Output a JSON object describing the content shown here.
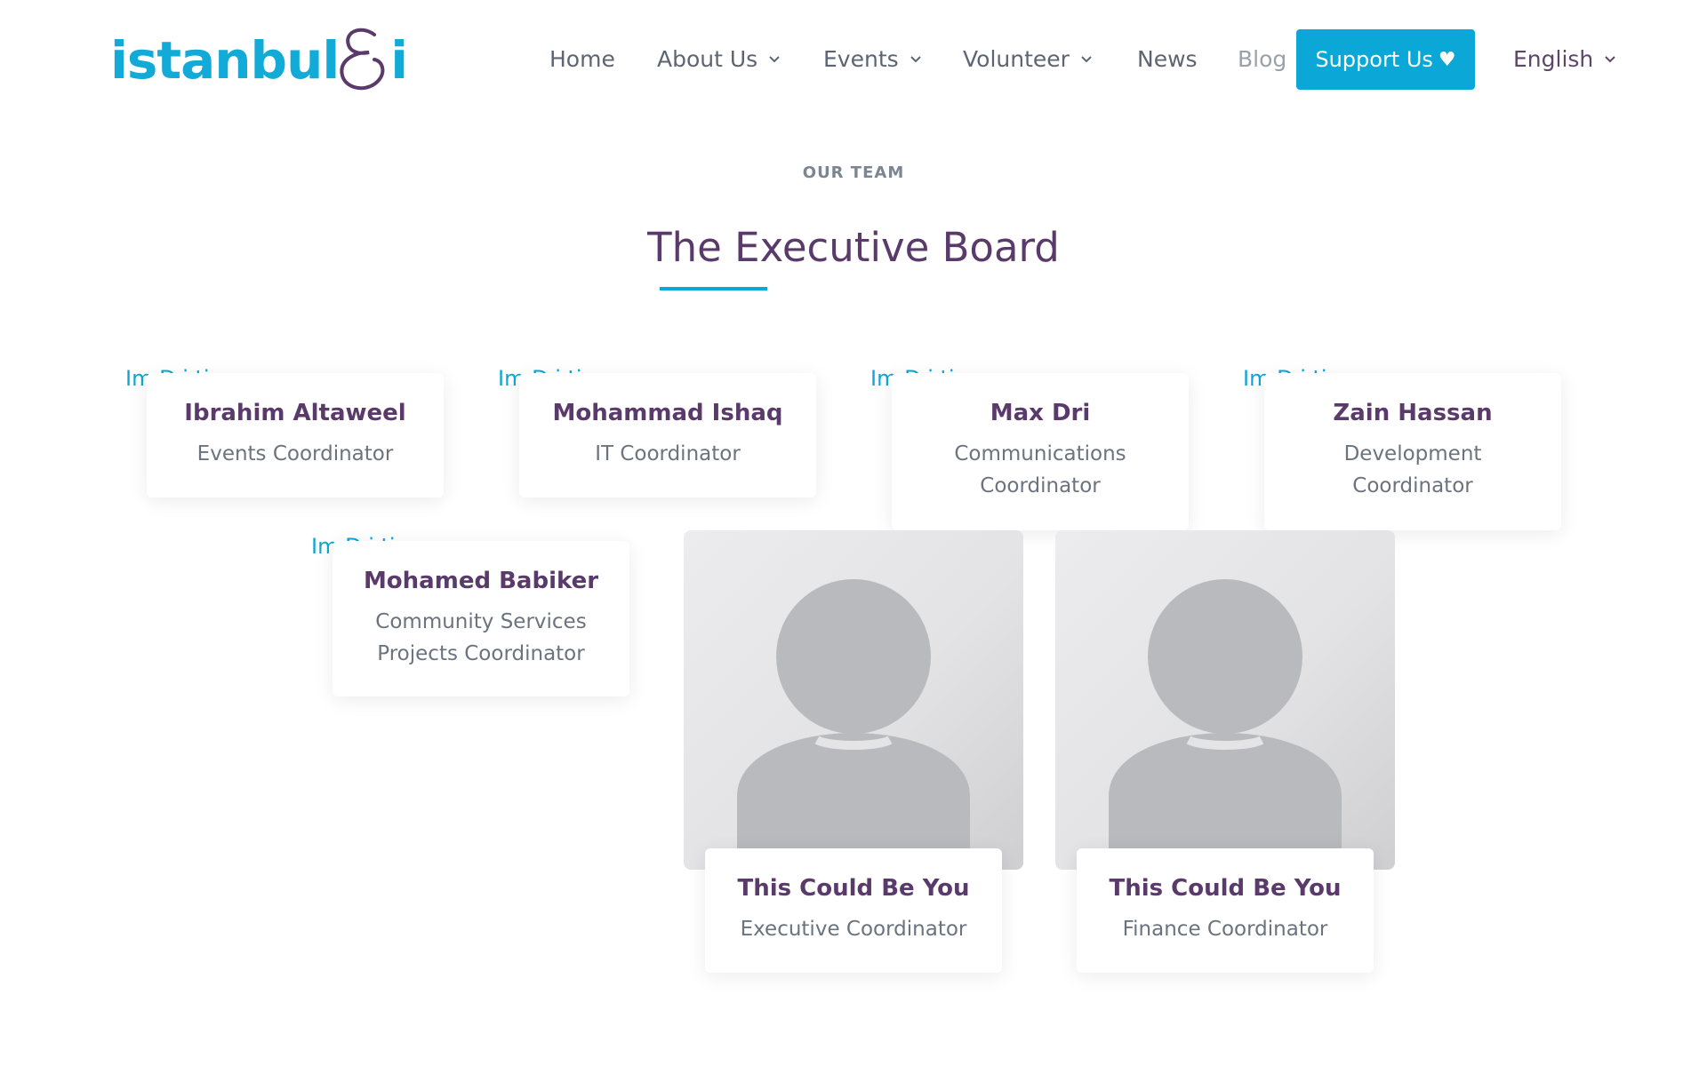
{
  "brand": {
    "logo_text": "istanbul",
    "logo_suffix": "i",
    "brand_color": "#12aad6",
    "accent_color": "#5a3a6a"
  },
  "nav": {
    "home": "Home",
    "about": "About Us",
    "events": "Events",
    "volunteer": "Volunteer",
    "news": "News",
    "blog": "Blog",
    "support": "Support Us",
    "support_icon": "heart-icon",
    "language": "English"
  },
  "section": {
    "eyebrow": "OUR TEAM",
    "title": "The Executive Board"
  },
  "team": [
    {
      "alt": "Im      D     i  ti",
      "name": "Ibrahim Altaweel",
      "role": "Events Coordinator"
    },
    {
      "alt": "Im      D     i  ti",
      "name": "Mohammad Ishaq",
      "role": "IT Coordinator"
    },
    {
      "alt": "Im      D     i  ti",
      "name": "Max Dri",
      "role": "Communications Coordinator"
    },
    {
      "alt": "Im      D     i  ti",
      "name": "Zain Hassan",
      "role": "Development Coordinator"
    },
    {
      "alt": "Im      D     i  ti",
      "name": "Mohamed Babiker",
      "role": "Community Services Projects Coordinator"
    },
    {
      "name": "This Could Be You",
      "role": "Executive Coordinator",
      "photo": "placeholder-avatar"
    },
    {
      "name": "This Could Be You",
      "role": "Finance Coordinator",
      "photo": "placeholder-avatar"
    }
  ]
}
